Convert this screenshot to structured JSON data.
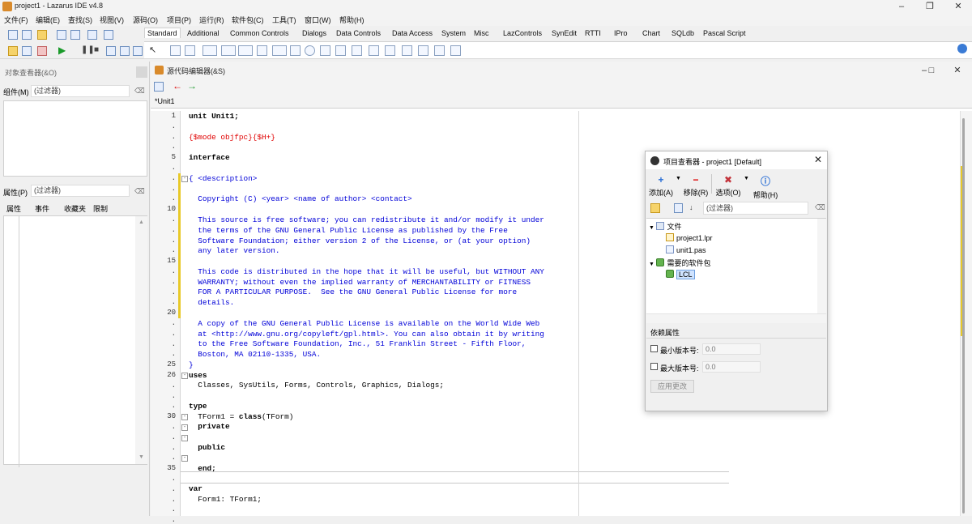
{
  "window": {
    "title": "project1  - Lazarus IDE v4.8"
  },
  "menubar": [
    "文件(F)",
    "编辑(E)",
    "查找(S)",
    "视图(V)",
    "源码(O)",
    "项目(P)",
    "运行(R)",
    "软件包(C)",
    "工具(T)",
    "窗口(W)",
    "帮助(H)"
  ],
  "palette": {
    "tabs": [
      "Standard",
      "Additional",
      "Common Controls",
      "Dialogs",
      "Data Controls",
      "Data Access",
      "System",
      "Misc",
      "LazControls",
      "SynEdit",
      "RTTI",
      "IPro",
      "Chart",
      "SQLdb",
      "Pascal Script"
    ],
    "active_tab": "Standard"
  },
  "object_inspector": {
    "title": "对象查看器(&O)",
    "components_label": "组件(M)",
    "components_filter": "(过滤器)",
    "props_label": "属性(P)",
    "props_filter": "(过滤器)",
    "tabs": [
      "属性",
      "事件",
      "收藏夹",
      "限制"
    ]
  },
  "source_editor": {
    "title": "源代码编辑器(&S)",
    "tab": "*Unit1",
    "line_numbers": [
      {
        "row": 0,
        "n": "1"
      },
      {
        "row": 1,
        "n": "."
      },
      {
        "row": 2,
        "n": "."
      },
      {
        "row": 3,
        "n": "."
      },
      {
        "row": 4,
        "n": "5"
      },
      {
        "row": 5,
        "n": "."
      },
      {
        "row": 6,
        "n": "."
      },
      {
        "row": 7,
        "n": "."
      },
      {
        "row": 8,
        "n": "."
      },
      {
        "row": 9,
        "n": "10"
      },
      {
        "row": 10,
        "n": "."
      },
      {
        "row": 11,
        "n": "."
      },
      {
        "row": 12,
        "n": "."
      },
      {
        "row": 13,
        "n": "."
      },
      {
        "row": 14,
        "n": "15"
      },
      {
        "row": 15,
        "n": "."
      },
      {
        "row": 16,
        "n": "."
      },
      {
        "row": 17,
        "n": "."
      },
      {
        "row": 18,
        "n": "."
      },
      {
        "row": 19,
        "n": "20"
      },
      {
        "row": 20,
        "n": "."
      },
      {
        "row": 21,
        "n": "."
      },
      {
        "row": 22,
        "n": "."
      },
      {
        "row": 23,
        "n": "."
      },
      {
        "row": 24,
        "n": "25"
      },
      {
        "row": 25,
        "n": "26"
      },
      {
        "row": 26,
        "n": "."
      },
      {
        "row": 27,
        "n": "."
      },
      {
        "row": 28,
        "n": "."
      },
      {
        "row": 29,
        "n": "30"
      },
      {
        "row": 30,
        "n": "."
      },
      {
        "row": 31,
        "n": "."
      },
      {
        "row": 32,
        "n": "."
      },
      {
        "row": 33,
        "n": "."
      },
      {
        "row": 34,
        "n": "35"
      },
      {
        "row": 35,
        "n": "."
      },
      {
        "row": 36,
        "n": "."
      },
      {
        "row": 37,
        "n": "."
      },
      {
        "row": 38,
        "n": "."
      },
      {
        "row": 39,
        "n": "."
      }
    ],
    "code": {
      "l1": "unit Unit1;",
      "l3": "{$mode objfpc}{$H+}",
      "l5": "interface",
      "l7": "{ <description>",
      "l9": "  Copyright (C) <year> <name of author> <contact>",
      "l11": "  This source is free software; you can redistribute it and/or modify it under",
      "l12": "  the terms of the GNU General Public License as published by the Free",
      "l13": "  Software Foundation; either version 2 of the License, or (at your option)",
      "l14": "  any later version.",
      "l16": "  This code is distributed in the hope that it will be useful, but WITHOUT ANY",
      "l17": "  WARRANTY; without even the implied warranty of MERCHANTABILITY or FITNESS",
      "l18": "  FOR A PARTICULAR PURPOSE.  See the GNU General Public License for more",
      "l19": "  details.",
      "l21": "  A copy of the GNU General Public License is available on the World Wide Web",
      "l22": "  at <http://www.gnu.org/copyleft/gpl.html>. You can also obtain it by writing",
      "l23": "  to the Free Software Foundation, Inc., 51 Franklin Street - Fifth Floor,",
      "l24": "  Boston, MA 02110-1335, USA.",
      "l25": "}",
      "l26": "uses",
      "l27": "  Classes, SysUtils, Forms, Controls, Graphics, Dialogs;",
      "l29": "type",
      "l30a": "  TForm1 = ",
      "l30b": "class",
      "l30c": "(TForm)",
      "l31": "  private",
      "l33": "  public",
      "l35": "  end;",
      "l37": "var",
      "l38": "  Form1: TForm1;"
    }
  },
  "project_inspector": {
    "title": "项目查看器 - project1 [Default]",
    "buttons": {
      "add": "添加(A)",
      "remove": "移除(R)",
      "options": "选项(O)",
      "help": "帮助(H)"
    },
    "filter": "(过滤器)",
    "tree": {
      "files": "文件",
      "file1": "project1.lpr",
      "file2": "unit1.pas",
      "packages": "需要的软件包",
      "pkg1": "LCL"
    },
    "deps": {
      "title": "依赖属性",
      "min_label": "最小版本号:",
      "min_value": "0.0",
      "max_label": "最大版本号:",
      "max_value": "0.0",
      "apply": "应用更改"
    }
  }
}
